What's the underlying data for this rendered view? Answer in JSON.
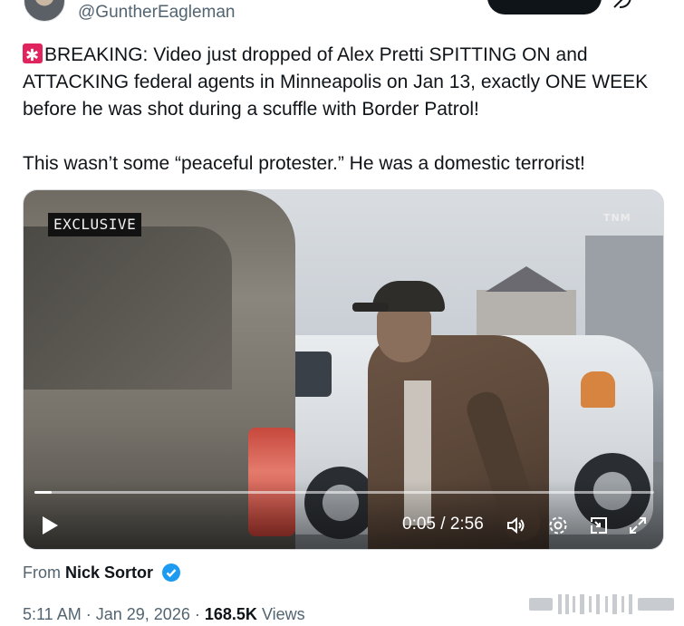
{
  "author": {
    "handle": "@GuntherEagleman",
    "avatar_icon": "user-avatar"
  },
  "tweet": {
    "paragraph_1": "BREAKING: Video just dropped of Alex Pretti SPITTING ON and ATTACKING federal agents in Minneapolis on Jan 13, exactly ONE WEEK before he was shot during a scuffle with Border Patrol!",
    "paragraph_2": "This wasn’t some “peaceful protester.” He was a domestic terrorist!",
    "emoji_icon": "police-siren-icon"
  },
  "video": {
    "badge": "EXCLUSIVE",
    "watermark": "TNM",
    "time": "0:05 / 2:56",
    "progress_fraction": 0.028
  },
  "attribution": {
    "prefix": "From",
    "name": "Nick Sortor"
  },
  "meta": {
    "time": "5:11 AM",
    "sep1": "·",
    "date": "Jan 29, 2026",
    "sep2": "·",
    "views": "168.5K",
    "views_label": "Views"
  },
  "colors": {
    "text": "#0f1419",
    "secondary": "#536471",
    "verified": "#1d9bf0"
  }
}
